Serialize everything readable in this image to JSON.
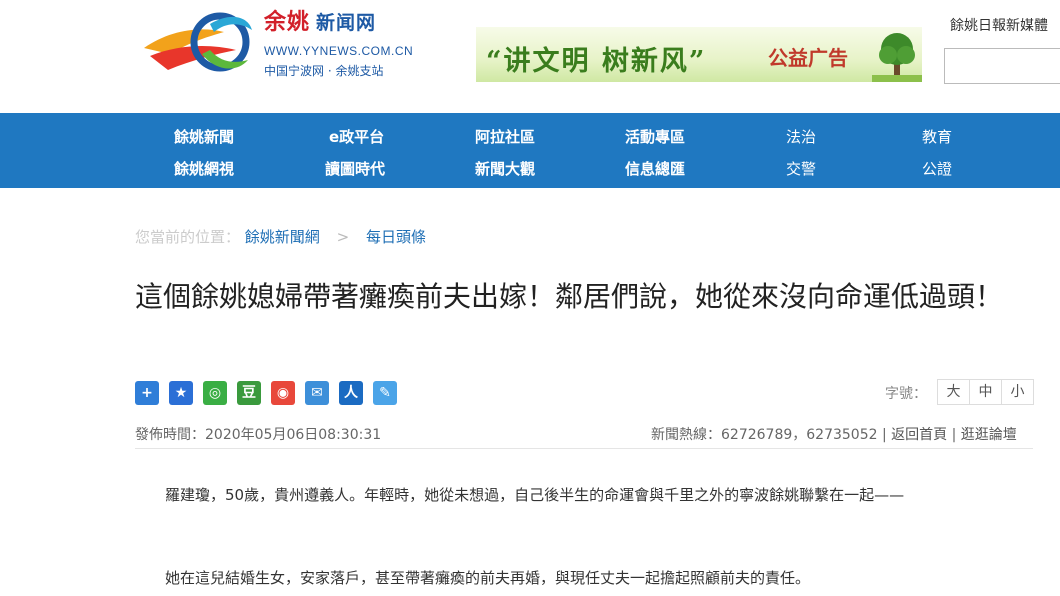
{
  "header": {
    "logo": {
      "title": "余姚",
      "subtitle": "新闻网",
      "url": "WWW.YYNEWS.COM.CN",
      "tagline": "中国宁波网 · 余姚支站"
    },
    "banner": {
      "slogan": "“讲文明 树新风”",
      "tag": "公益广告"
    },
    "site_link": "餘姚日報新媒體",
    "search": {
      "placeholder": ""
    }
  },
  "nav": {
    "row1": [
      "餘姚新聞",
      "e政平台",
      "阿拉社區",
      "活動專區",
      "法治",
      "教育"
    ],
    "row2": [
      "餘姚網視",
      "讀圖時代",
      "新聞大觀",
      "信息總匯",
      "交警",
      "公證"
    ]
  },
  "breadcrumb": {
    "prefix": "您當前的位置：",
    "items": [
      "餘姚新聞網",
      "每日頭條"
    ],
    "separator": ">"
  },
  "article": {
    "title": "這個餘姚媳婦帶著癱瘓前夫出嫁！鄰居們說，她從來沒向命運低過頭！",
    "publish": "發佈時間：2020年05月06日08:30:31",
    "hotline": "新聞熱線：62726789，62735052",
    "divider": "|",
    "back_home": "返回首頁",
    "forum": "逛逛論壇",
    "paragraphs": [
      "　　羅建瓊，50歲，貴州遵義人。年輕時，她從未想過，自己後半生的命運會與千里之外的寧波餘姚聯繫在一起——",
      "　　她在這兒結婚生女，安家落戶，甚至帶著癱瘓的前夫再婚，與現任丈夫一起擔起照顧前夫的責任。"
    ]
  },
  "share": {
    "buttons": [
      {
        "icon": "plus-icon",
        "glyph": "+",
        "color": "#2f7ed8"
      },
      {
        "icon": "star-icon",
        "glyph": "★",
        "color": "#2b6fd6"
      },
      {
        "icon": "wechat-icon",
        "glyph": "◎",
        "color": "#3aae44"
      },
      {
        "icon": "douban-icon",
        "glyph": "豆",
        "color": "#3a9a3d"
      },
      {
        "icon": "weibo-icon",
        "glyph": "◉",
        "color": "#e8483b"
      },
      {
        "icon": "tencent-weibo-icon",
        "glyph": "✉",
        "color": "#3d8fd9"
      },
      {
        "icon": "renren-icon",
        "glyph": "人",
        "color": "#1b6bc2"
      },
      {
        "icon": "edit-icon",
        "glyph": "✎",
        "color": "#4ba4e8"
      }
    ]
  },
  "fontsize": {
    "label": "字號：",
    "options": [
      "大",
      "中",
      "小"
    ]
  },
  "colors": {
    "nav_bg": "#1f78c1",
    "link": "#1f6fb5",
    "logo_red": "#d2202a",
    "logo_blue": "#1e5aa5"
  }
}
